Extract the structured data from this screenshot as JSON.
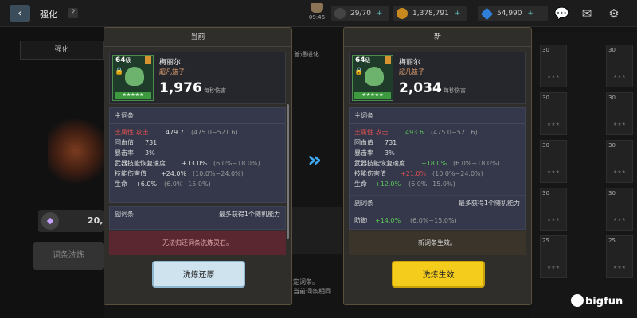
{
  "topbar": {
    "title": "强化",
    "help": "?",
    "clock_time": "09:46",
    "energy": "29/70",
    "gold": "1,378,791",
    "gems": "54,990",
    "plus": "+"
  },
  "background": {
    "tab_label": "强化",
    "mid_label": "普通进化",
    "badge_value": "20,",
    "option_button": "词条洗炼",
    "mid_text_1": "定词条。",
    "mid_text_2": "当前词条相同",
    "slot_levels": [
      "30",
      "30",
      "30",
      "30",
      "30",
      "30",
      "30",
      "30",
      "25",
      "25"
    ]
  },
  "colors": {
    "accent_blue": "#3fa9f5",
    "confirm_yellow": "#f4cc1c",
    "red_stat": "#e05050",
    "green_stat": "#5ac85a"
  },
  "left_panel": {
    "header": "当前",
    "level": "64",
    "level_unit": "级",
    "rating": "★★★★★",
    "name": "梅丽尔",
    "subtitle": "超凡篮子",
    "dps": "1,976",
    "dps_label": "每秒伤害",
    "main_title": "主词条",
    "main_stats": [
      {
        "label": "土属性 攻击",
        "value": "479.7",
        "range": "(475.0~521.6)"
      },
      {
        "label": "回血值",
        "value": "731",
        "range": ""
      },
      {
        "label": "暴击率",
        "value": "3%",
        "range": ""
      },
      {
        "label": "武器技能恢复速度",
        "value": "+13.0%",
        "range": "(6.0%~18.0%)"
      },
      {
        "label": "技能伤害值",
        "value": "+24.0%",
        "range": "(10.0%~24.0%)"
      },
      {
        "label": "生命",
        "value": "+6.0%",
        "range": "(6.0%~15.0%)"
      }
    ],
    "sub_title": "副词条",
    "sub_note": "最多获得1个随机能力",
    "notice": "无法归还词条洗炼灵石。",
    "button": "洗炼还原"
  },
  "right_panel": {
    "header": "新",
    "level": "64",
    "level_unit": "级",
    "rating": "★★★★★",
    "name": "梅丽尔",
    "subtitle": "超凡篮子",
    "dps": "2,034",
    "dps_label": "每秒伤害",
    "main_title": "主词条",
    "main_stats": [
      {
        "label": "土属性 攻击",
        "value": "493.6",
        "range": "(475.0~521.6)"
      },
      {
        "label": "回血值",
        "value": "731",
        "range": ""
      },
      {
        "label": "暴击率",
        "value": "3%",
        "range": ""
      },
      {
        "label": "武器技能恢复速度",
        "value": "+18.0%",
        "range": "(6.0%~18.0%)"
      },
      {
        "label": "技能伤害值",
        "value": "+21.0%",
        "range": "(10.0%~24.0%)"
      },
      {
        "label": "生命",
        "value": "+12.0%",
        "range": "(6.0%~15.0%)"
      }
    ],
    "sub_title": "副词条",
    "sub_note": "最多获得1个随机能力",
    "sub_stats": [
      {
        "label": "防御",
        "value": "+14.0%",
        "range": "(6.0%~15.0%)"
      }
    ],
    "notice": "新词条生效。",
    "button": "洗炼生效"
  },
  "arrow": "»",
  "watermark": "bigfun"
}
